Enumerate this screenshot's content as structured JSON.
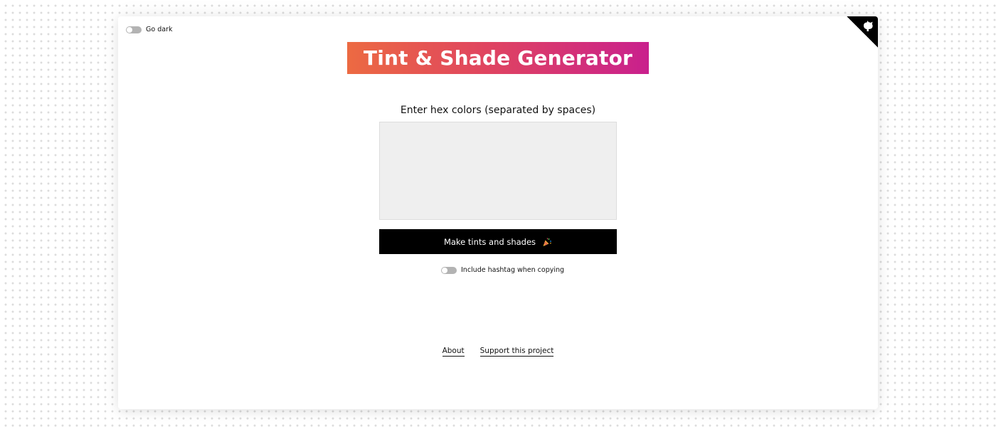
{
  "theme_toggle": {
    "label": "Go dark"
  },
  "corner": {
    "icon": "github-octocat-icon"
  },
  "header": {
    "title": "Tint & Shade Generator"
  },
  "form": {
    "prompt": "Enter hex colors (separated by spaces)",
    "input_value": "",
    "submit_label": "Make tints and shades",
    "submit_icon": "party-popper-icon"
  },
  "hashtag_toggle": {
    "label": "Include hashtag when copying"
  },
  "footer": {
    "links": [
      {
        "label": "About"
      },
      {
        "label": "Support this project"
      }
    ]
  },
  "colors": {
    "banner_start": "#ec6a42",
    "banner_end": "#c9208d",
    "button_bg": "#000000",
    "input_bg": "#efefef",
    "toggle_off": "#b3b3b3"
  }
}
